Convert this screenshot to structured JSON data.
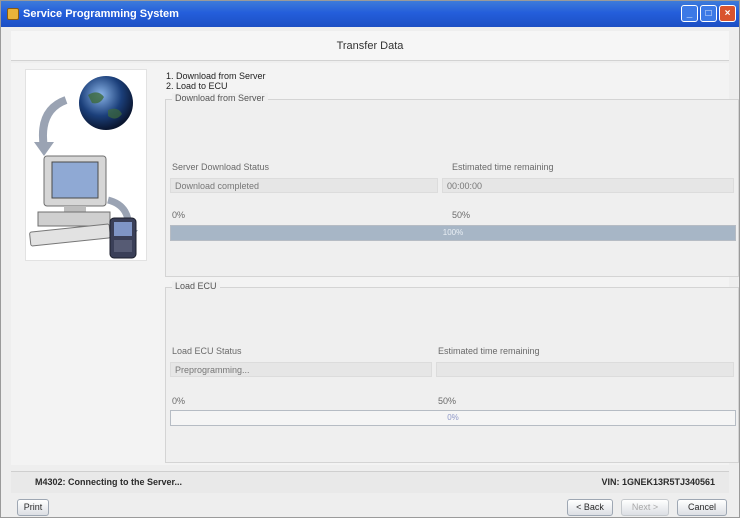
{
  "window": {
    "title": "Service Programming System"
  },
  "header": {
    "title": "Transfer Data"
  },
  "steps": [
    "1. Download from Server",
    "2. Load to ECU"
  ],
  "download_group": {
    "legend": "Download from Server",
    "status_label": "Server Download Status",
    "time_label": "Estimated time remaining",
    "status_value": "Download completed",
    "time_value": "00:00:00",
    "min_label": "0%",
    "max_label": "50%",
    "progress_fraction": 1.0,
    "progress_text": "100%"
  },
  "ecu_group": {
    "legend": "Load ECU",
    "status_label": "Load ECU Status",
    "time_label": "Estimated time remaining",
    "status_value": "Preprogramming...",
    "time_value": "",
    "min_label": "0%",
    "max_label": "50%",
    "progress_fraction": 0.0,
    "progress_text": "0%"
  },
  "status_bar": {
    "message": "M4302: Connecting to the Server...",
    "vin": "VIN: 1GNEK13R5TJ340561"
  },
  "buttons": {
    "print": "Print",
    "back": "< Back",
    "next": "Next >",
    "cancel": "Cancel"
  },
  "colors": {
    "titlebar": "#245edb",
    "progress_fill": "#a7b6c6"
  }
}
